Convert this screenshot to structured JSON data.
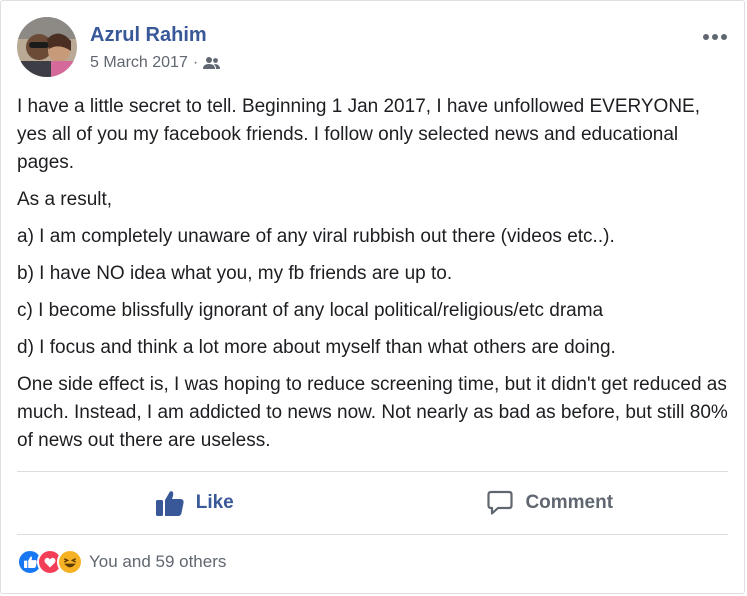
{
  "post": {
    "author": "Azrul Rahim",
    "date": "5 March 2017",
    "separator": "·",
    "audience_icon": "friends-icon",
    "paragraphs": [
      "I have a little secret to tell. Beginning 1 Jan 2017, I have unfollowed EVERYONE, yes all of you my facebook friends. I follow only selected news and educational pages.",
      "As a result,",
      "a) I am completely unaware of any viral rubbish out there (videos etc..).",
      "b) I have NO idea what you, my fb friends are up to.",
      "c) I become blissfully ignorant of any local political/religious/etc drama",
      "d) I focus and think a lot more about myself than what others are doing.",
      "One side effect is, I was hoping to reduce screening time, but it didn't get reduced as much. Instead, I am addicted to news now. Not nearly as bad as before, but still 80% of news out there are useless."
    ]
  },
  "actions": {
    "like_label": "Like",
    "comment_label": "Comment"
  },
  "reactions": {
    "icons": [
      "like-reaction-icon",
      "love-reaction-icon",
      "haha-reaction-icon"
    ],
    "summary": "You and 59 others"
  },
  "colors": {
    "author": "#385898",
    "like": "#1877f2",
    "love": "#f33e58",
    "haha": "#f7b125",
    "muted": "#606770"
  }
}
